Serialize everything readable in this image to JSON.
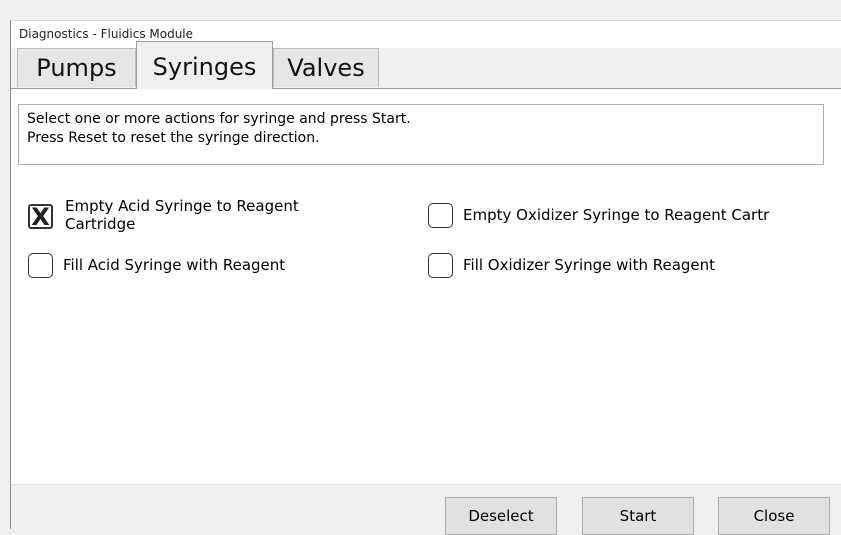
{
  "window": {
    "title": "Diagnostics - Fluidics Module"
  },
  "tabs": [
    {
      "label": "Pumps"
    },
    {
      "label": "Syringes",
      "active": true
    },
    {
      "label": "Valves"
    }
  ],
  "instructions": {
    "line1": "Select one or more actions for syringe and press Start.",
    "line2": "Press Reset to reset the syringe direction."
  },
  "actions": [
    {
      "label_line1": "Empty Acid Syringe to Reagent",
      "label_line2": "Cartridge",
      "checked": true,
      "mark": "X"
    },
    {
      "label_line1": "Empty Oxidizer Syringe to Reagent Cartr",
      "checked": false
    },
    {
      "label_line1": "Fill Acid Syringe with Reagent",
      "checked": false
    },
    {
      "label_line1": "Fill Oxidizer Syringe with Reagent",
      "checked": false
    }
  ],
  "buttons": {
    "deselect": "Deselect",
    "start": "Start",
    "close": "Close"
  }
}
